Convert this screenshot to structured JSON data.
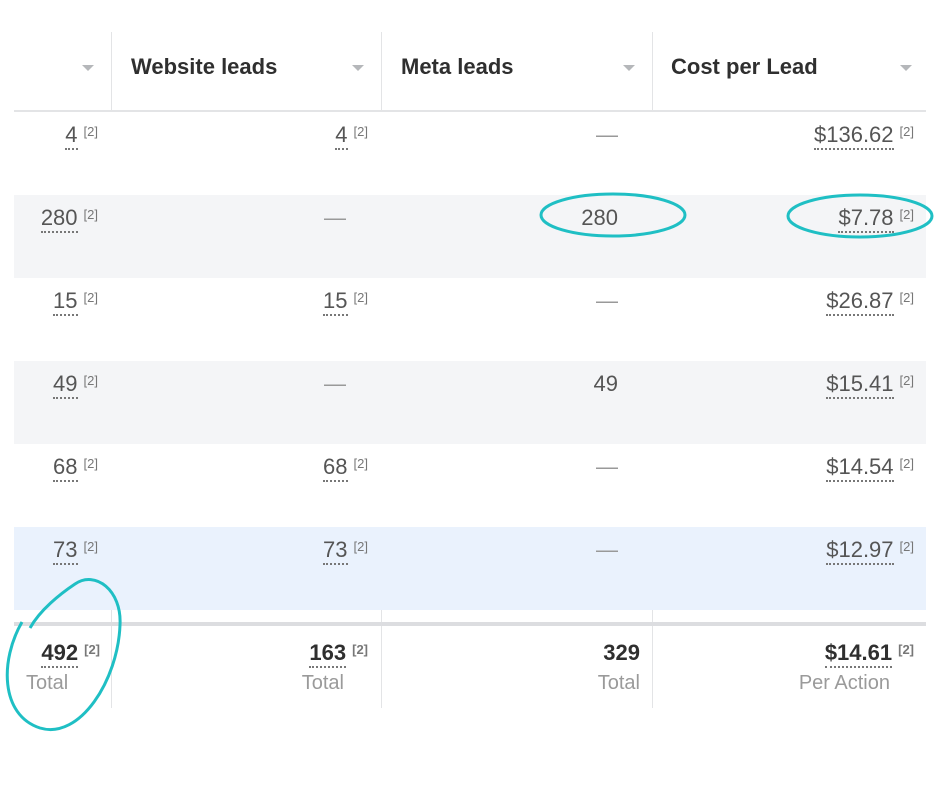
{
  "columns": [
    {
      "label": "",
      "has_sort": true
    },
    {
      "label": "Website leads",
      "has_sort": true
    },
    {
      "label": "Meta leads",
      "has_sort": true
    },
    {
      "label": "Cost per Lead",
      "has_sort": true
    }
  ],
  "footnote_marker": "[2]",
  "dash": "—",
  "rows": [
    {
      "results": "4",
      "website": "4",
      "meta": "—",
      "cpl": "$136.62"
    },
    {
      "results": "280",
      "website": "—",
      "meta": "280",
      "cpl": "$7.78"
    },
    {
      "results": "15",
      "website": "15",
      "meta": "—",
      "cpl": "$26.87"
    },
    {
      "results": "49",
      "website": "—",
      "meta": "49",
      "cpl": "$15.41"
    },
    {
      "results": "68",
      "website": "68",
      "meta": "—",
      "cpl": "$14.54"
    },
    {
      "results": "73",
      "website": "73",
      "meta": "—",
      "cpl": "$12.97"
    }
  ],
  "totals": {
    "results": {
      "value": "492",
      "label": "Total"
    },
    "website": {
      "value": "163",
      "label": "Total"
    },
    "meta": {
      "value": "329",
      "label": "Total"
    },
    "cpl": {
      "value": "$14.61",
      "label": "Per Action"
    }
  },
  "colors": {
    "row_alt": "#f4f5f7",
    "row_highlight": "#eaf2fd",
    "annotation": "#1fbfc4"
  }
}
